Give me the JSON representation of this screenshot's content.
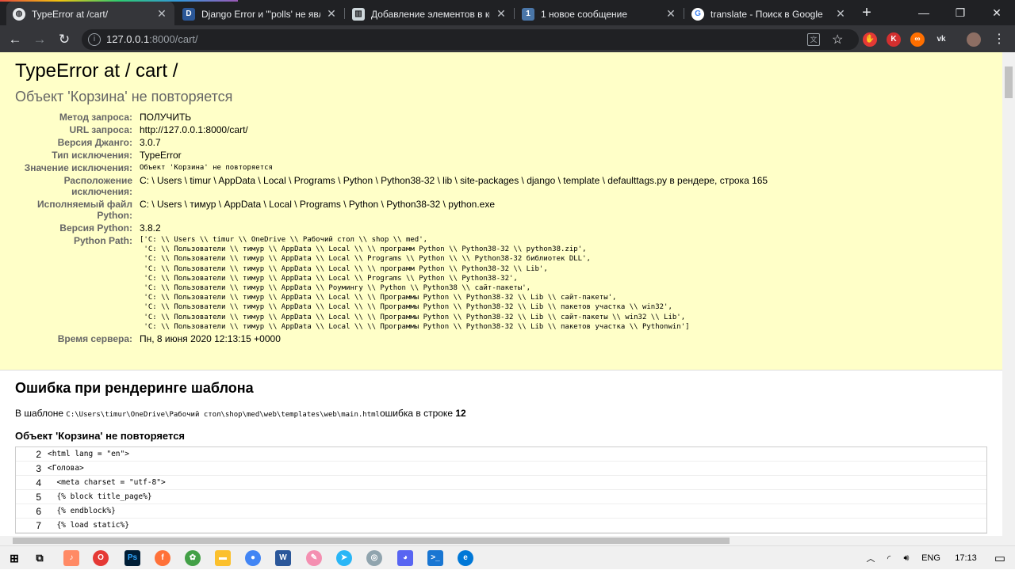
{
  "browser": {
    "tabs": [
      {
        "title": "TypeError at /cart/",
        "icon": "globe-icon",
        "color": "#e8eaed"
      },
      {
        "title": "Django Error и \"'polls' не являет",
        "icon": "django-icon",
        "color": "#2b5797"
      },
      {
        "title": "Добавление элементов в кор",
        "icon": "book-icon",
        "color": "#cfd8dc"
      },
      {
        "title": "1 новое сообщение",
        "icon": "vk-icon",
        "color": "#4a76a8"
      },
      {
        "title": "translate - Поиск в Google",
        "icon": "google-icon",
        "color": "#ffffff"
      }
    ],
    "new_tab": "+",
    "url_host": "127.0.0.1",
    "url_rest": ":8000/cart/"
  },
  "error": {
    "title": "TypeError at / cart /",
    "subtitle": "Объект 'Корзина' не повторяется",
    "meta": [
      {
        "k": "Метод запроса:",
        "v": "ПОЛУЧИТЬ"
      },
      {
        "k": "URL запроса:",
        "v": "http://127.0.0.1:8000/cart/"
      },
      {
        "k": "Версия Джанго:",
        "v": "3.0.7"
      },
      {
        "k": "Тип исключения:",
        "v": "TypeError"
      },
      {
        "k": "Значение исключения:",
        "v": "Объект 'Корзина' не повторяется"
      },
      {
        "k": "Расположение исключения:",
        "v": "C: \\ Users \\ timur \\ AppData \\ Local \\ Programs \\ Python \\ Python38-32 \\ lib \\ site-packages \\ django \\ template \\ defaulttags.py в рендере, строка 165"
      },
      {
        "k": "Исполняемый файл Python:",
        "v": "C: \\ Users \\ тимур \\ AppData \\ Local \\ Programs \\ Python \\ Python38-32 \\ python.exe"
      },
      {
        "k": "Версия Python:",
        "v": "3.8.2"
      },
      {
        "k": "Python Path:",
        "v": "['C: \\\\ Users \\\\ timur \\\\ OneDrive \\\\ Рабочий стол \\\\ shop \\\\ med',\n 'C: \\\\ Пользователи \\\\ тимур \\\\ AppData \\\\ Local \\\\ \\\\ программ Python \\\\ Python38-32 \\\\ python38.zip',\n 'C: \\\\ Пользователи \\\\ тимур \\\\ AppData \\\\ Local \\\\ Programs \\\\ Python \\\\ \\\\ Python38-32 библиотек DLL',\n 'C: \\\\ Пользователи \\\\ тимур \\\\ AppData \\\\ Local \\\\ \\\\ программ Python \\\\ Python38-32 \\\\ Lib',\n 'C: \\\\ Пользователи \\\\ тимур \\\\ AppData \\\\ Local \\\\ Programs \\\\ Python \\\\ Python38-32',\n 'C: \\\\ Пользователи \\\\ тимур \\\\ AppData \\\\ Роумингу \\\\ Python \\\\ Python38 \\\\ сайт-пакеты',\n 'C: \\\\ Пользователи \\\\ тимур \\\\ AppData \\\\ Local \\\\ \\\\ Программы Python \\\\ Python38-32 \\\\ Lib \\\\ сайт-пакеты',\n 'C: \\\\ Пользователи \\\\ тимур \\\\ AppData \\\\ Local \\\\ \\\\ Программы Python \\\\ Python38-32 \\\\ Lib \\\\ пакетов участка \\\\ win32',\n 'C: \\\\ Пользователи \\\\ тимур \\\\ AppData \\\\ Local \\\\ \\\\ Программы Python \\\\ Python38-32 \\\\ Lib \\\\ сайт-пакеты \\\\ win32 \\\\ Lib',\n 'C: \\\\ Пользователи \\\\ тимур \\\\ AppData \\\\ Local \\\\ \\\\ Программы Python \\\\ Python38-32 \\\\ Lib \\\\ пакетов участка \\\\ Pythonwin']"
      },
      {
        "k": "Время сервера:",
        "v": "Пн, 8 июня 2020 12:13:15 +0000"
      }
    ]
  },
  "template_error": {
    "heading": "Ошибка при рендеринге шаблона",
    "intro_prefix": "В шаблоне ",
    "path": "C:\\Users\\timur\\OneDrive\\Рабочий стол\\shop\\med\\web\\templates\\web\\main.html",
    "intro_mid": "ошибка в строке ",
    "line": "12",
    "subheading": "Объект 'Корзина' не повторяется",
    "lines": [
      {
        "n": "2",
        "code": "<html lang = \"en\">"
      },
      {
        "n": "3",
        "code": "<Голова>"
      },
      {
        "n": "4",
        "code": "  <meta charset = \"utf-8\">"
      },
      {
        "n": "5",
        "code": "  {% block title_page%}"
      },
      {
        "n": "6",
        "code": "  {% endblock%}"
      },
      {
        "n": "7",
        "code": "  {% load static%}"
      }
    ]
  },
  "taskbar": {
    "lang": "ENG",
    "time": "17:13"
  }
}
